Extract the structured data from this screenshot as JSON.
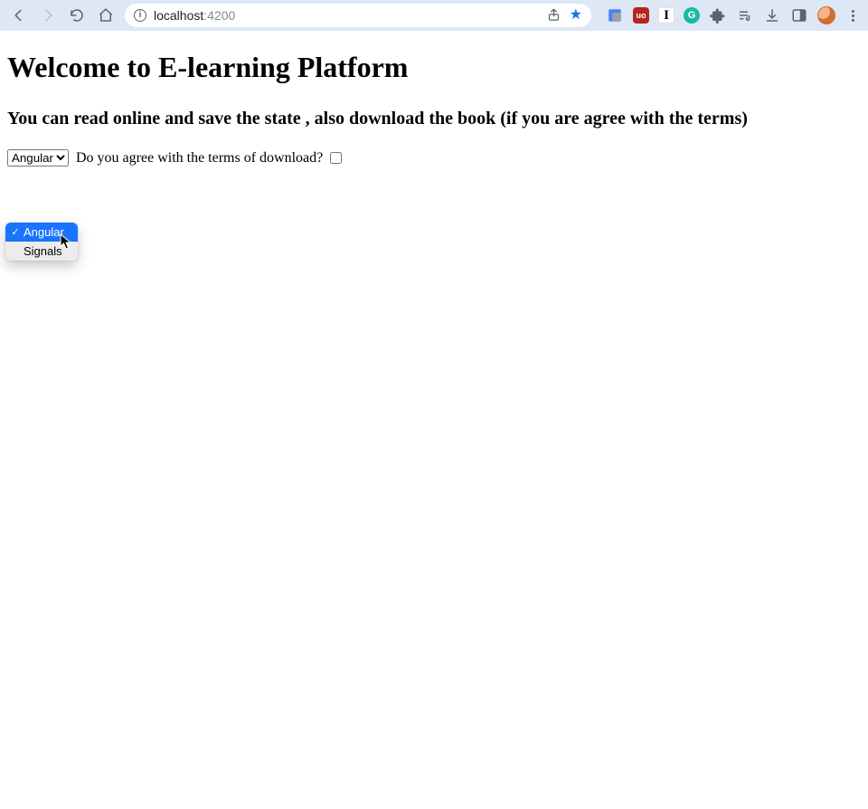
{
  "browser": {
    "url_host": "localhost",
    "url_port": ":4200",
    "site_info_glyph": "i",
    "star_glyph": "★",
    "share_glyph": "⇧",
    "ext_shield_label": "uo",
    "ext_serif_label": "I",
    "ext_circle_label": "G"
  },
  "page": {
    "h1": "Welcome to E-learning Platform",
    "h3": "You can read online and save the state , also download the book (if you are agree with the terms)",
    "terms_label": "Do you agree with the terms of download?"
  },
  "select": {
    "options": [
      {
        "label": "Angular",
        "selected": true
      },
      {
        "label": "Signals",
        "selected": false
      }
    ]
  }
}
